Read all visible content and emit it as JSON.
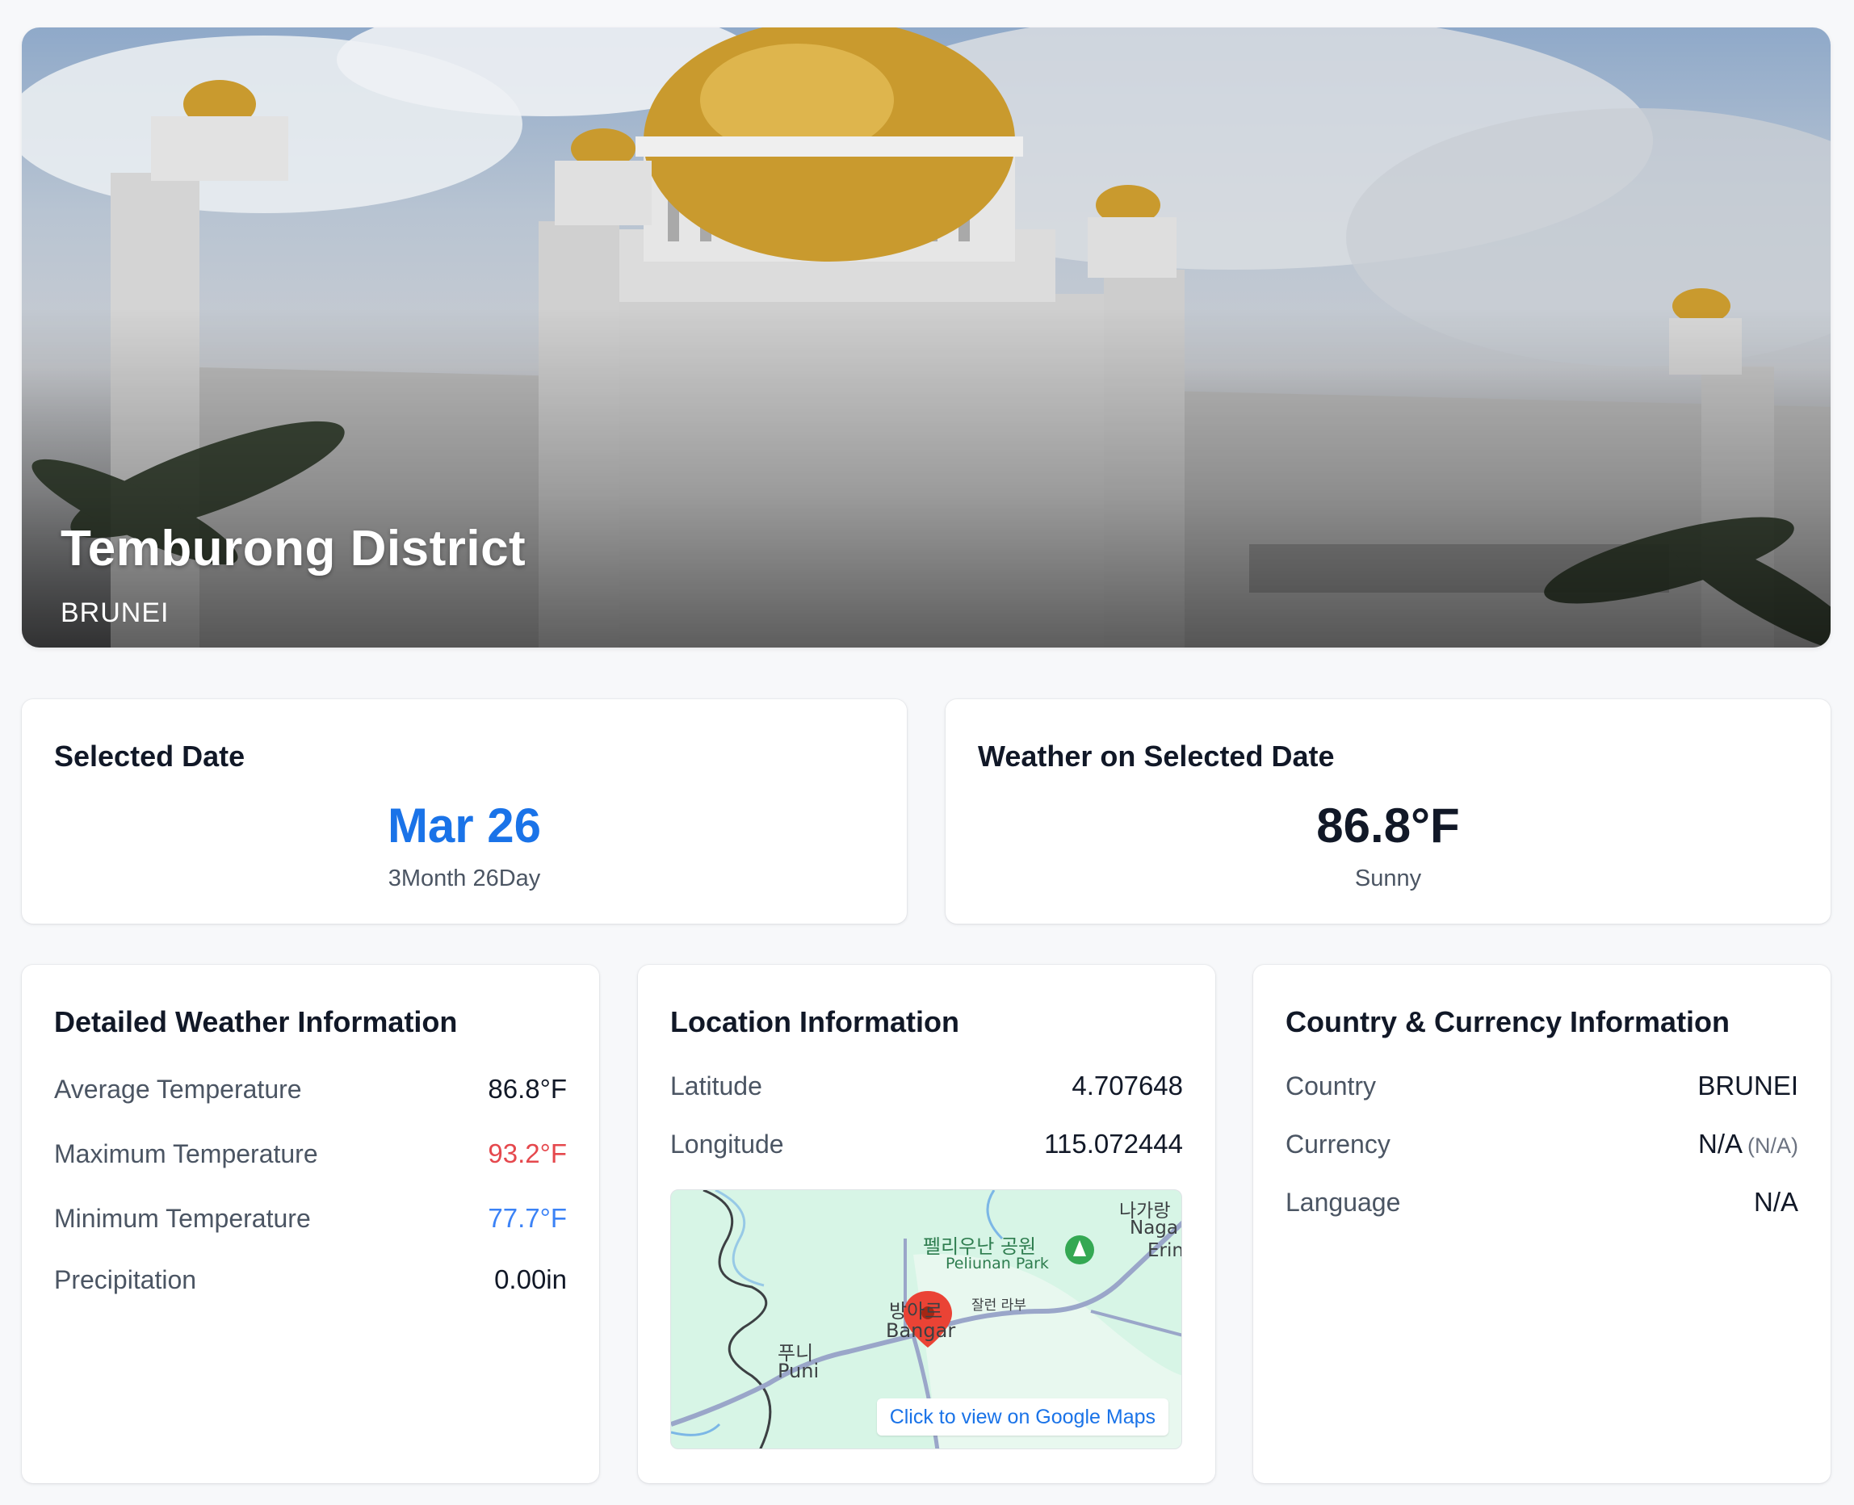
{
  "hero": {
    "title": "Temburong District",
    "subtitle": "BRUNEI"
  },
  "selected_date": {
    "title": "Selected Date",
    "date": "Mar 26",
    "detail": "3Month 26Day"
  },
  "weather": {
    "title": "Weather on Selected Date",
    "temperature": "86.8°F",
    "condition": "Sunny"
  },
  "detailed_weather": {
    "title": "Detailed Weather Information",
    "rows": [
      {
        "label": "Average Temperature",
        "value": "86.8°F"
      },
      {
        "label": "Maximum Temperature",
        "value": "93.2°F"
      },
      {
        "label": "Minimum Temperature",
        "value": "77.7°F"
      },
      {
        "label": "Precipitation",
        "value": "0.00in"
      }
    ]
  },
  "location": {
    "title": "Location Information",
    "rows": [
      {
        "label": "Latitude",
        "value": "4.707648"
      },
      {
        "label": "Longitude",
        "value": "115.072444"
      }
    ],
    "map": {
      "button_label": "Click to view on Google Maps",
      "labels": {
        "park_ko": "펠리우난 공원",
        "park_en": "Peliunan Park",
        "bangar_ko": "방아르",
        "bangar_en": "Bangar",
        "puni_ko": "푸니",
        "puni_en": "Puni",
        "road_ko": "잘런 라부",
        "naga_ko": "나가랑",
        "naga_en": "Naga",
        "erin": "Erin"
      }
    }
  },
  "country": {
    "title": "Country & Currency Information",
    "rows": [
      {
        "label": "Country",
        "value": "BRUNEI"
      },
      {
        "label": "Currency",
        "value": "N/A",
        "extra": "(N/A)"
      },
      {
        "label": "Language",
        "value": "N/A"
      }
    ]
  },
  "colors": {
    "accent_blue": "#1a73e8",
    "max_temp_red": "#e5484d",
    "min_temp_blue": "#3b82f6",
    "map_green": "#d7f5e6",
    "marker_red": "#ea4335"
  }
}
